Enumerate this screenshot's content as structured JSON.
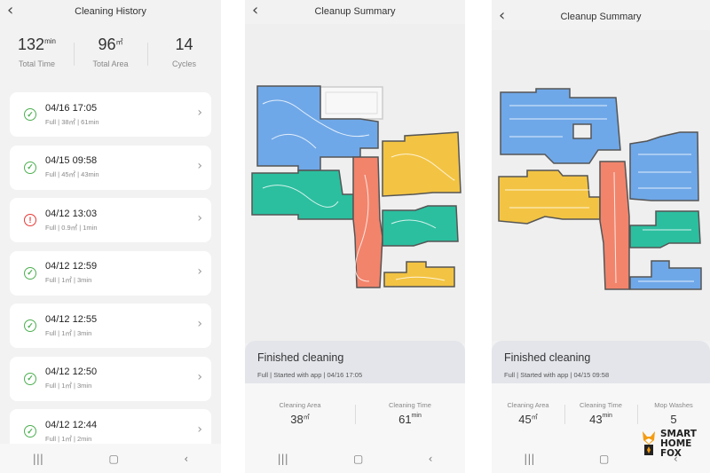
{
  "history": {
    "title": "Cleaning History",
    "stats": [
      {
        "value": "132",
        "unit": "min",
        "label": "Total Time"
      },
      {
        "value": "96",
        "unit": "㎡",
        "label": "Total Area"
      },
      {
        "value": "14",
        "unit": "",
        "label": "Cycles"
      }
    ],
    "records": [
      {
        "datetime": "04/16 17:05",
        "detail": "Full | 38㎡ | 61min",
        "status": "ok"
      },
      {
        "datetime": "04/15 09:58",
        "detail": "Full | 45㎡ | 43min",
        "status": "ok"
      },
      {
        "datetime": "04/12 13:03",
        "detail": "Full | 0.9㎡ | 1min",
        "status": "error"
      },
      {
        "datetime": "04/12 12:59",
        "detail": "Full | 1㎡ | 3min",
        "status": "ok"
      },
      {
        "datetime": "04/12 12:55",
        "detail": "Full | 1㎡ | 3min",
        "status": "ok"
      },
      {
        "datetime": "04/12 12:50",
        "detail": "Full | 1㎡ | 3min",
        "status": "ok"
      },
      {
        "datetime": "04/12 12:44",
        "detail": "Full | 1㎡ | 2min",
        "status": "ok"
      }
    ]
  },
  "summary1": {
    "title": "Cleanup Summary",
    "status_title": "Finished cleaning",
    "meta": "Full | Started with app | 04/16 17:05",
    "metrics": [
      {
        "label": "Cleaning Area",
        "value": "38",
        "unit": "㎡"
      },
      {
        "label": "Cleaning Time",
        "value": "61",
        "unit": "min"
      }
    ]
  },
  "summary2": {
    "title": "Cleanup Summary",
    "status_title": "Finished cleaning",
    "meta": "Full | Started with app | 04/15 09:58",
    "metrics": [
      {
        "label": "Cleaning Area",
        "value": "45",
        "unit": "㎡"
      },
      {
        "label": "Cleaning Time",
        "value": "43",
        "unit": "min"
      },
      {
        "label": "Mop Washes",
        "value": "5",
        "unit": ""
      }
    ]
  },
  "icons": {
    "back": "chevron-left-icon",
    "chevron": "chevron-right-icon",
    "ok": "check-circle-icon",
    "error": "alert-circle-icon",
    "nav_recents": "recents-icon",
    "nav_home": "home-icon",
    "nav_back": "back-icon"
  },
  "nav_glyphs": {
    "recents": "|||",
    "home": "▢",
    "back": "‹"
  },
  "colors": {
    "room_blue": "#6fa8e8",
    "room_teal": "#2bbf9f",
    "room_yellow": "#f3c443",
    "room_salmon": "#f2846c",
    "ok_green": "#4caf50",
    "error_red": "#e53935"
  },
  "brand": {
    "line1": "SMART",
    "line2": "HOME",
    "line3": "FOX"
  }
}
